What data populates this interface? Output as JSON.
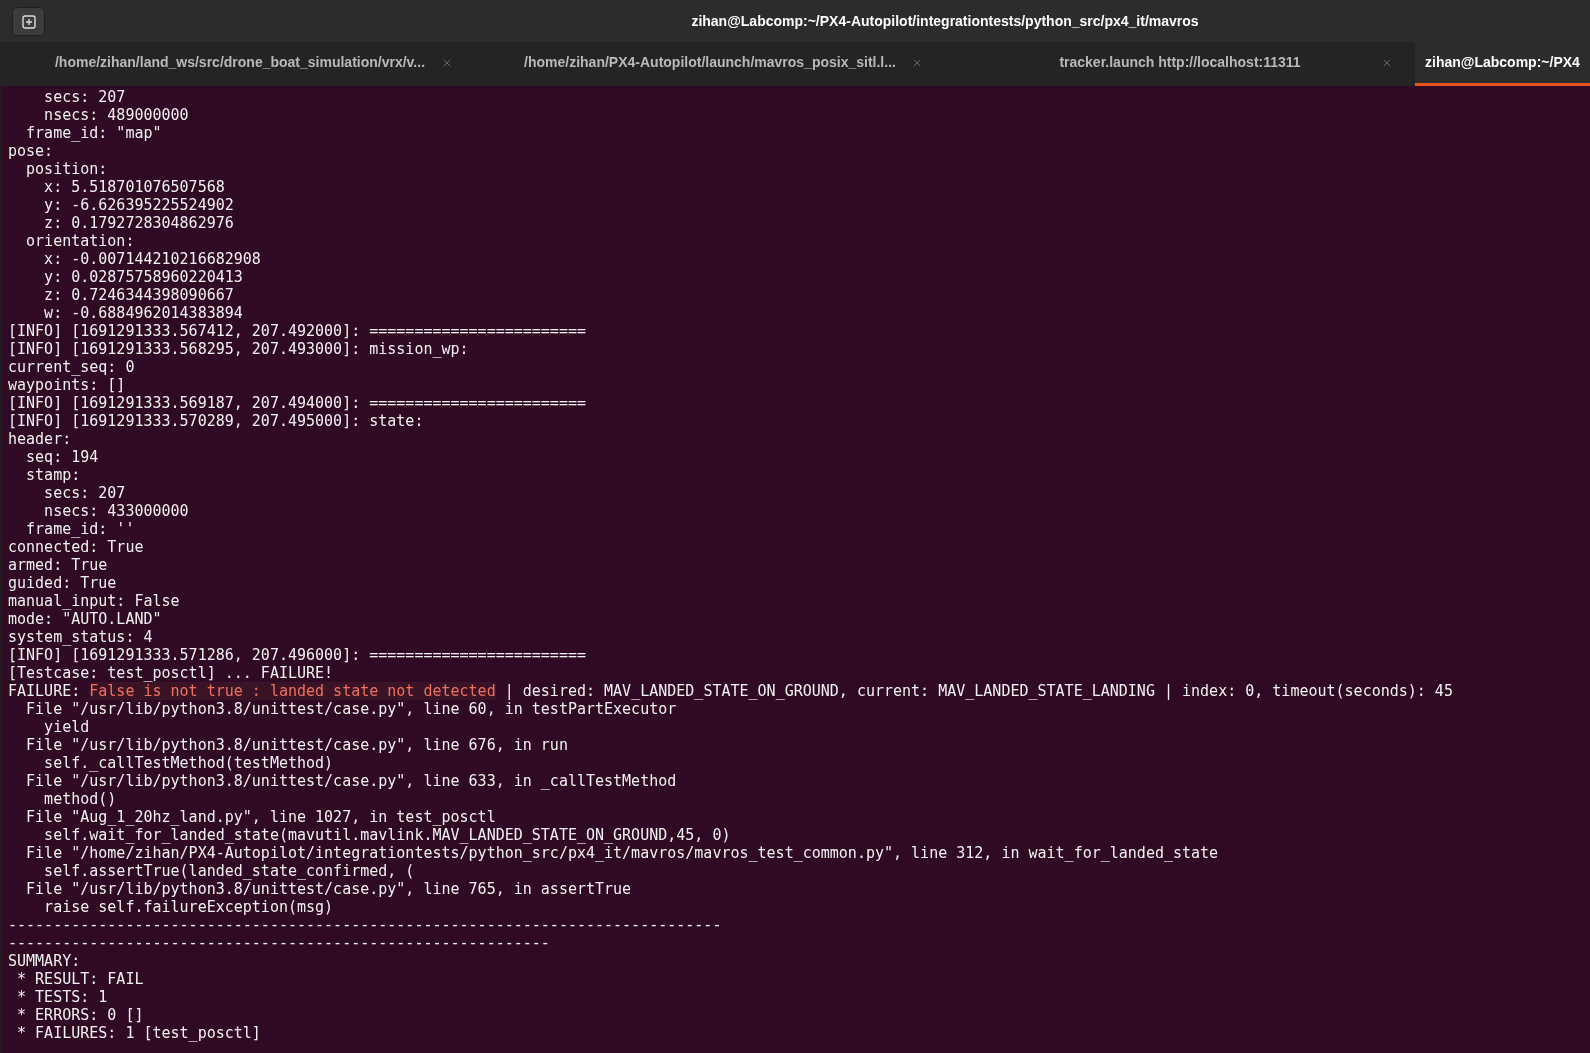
{
  "window": {
    "title": "zihan@Labcomp:~/PX4-Autopilot/integrationtests/python_src/px4_it/mavros"
  },
  "tabs": [
    {
      "label": "/home/zihan/land_ws/src/drone_boat_simulation/vrx/v...",
      "selected": false
    },
    {
      "label": "/home/zihan/PX4-Autopilot/launch/mavros_posix_sitl.l...",
      "selected": false
    },
    {
      "label": "tracker.launch http://localhost:11311",
      "selected": false
    },
    {
      "label": "zihan@Labcomp:~/PX4",
      "selected": true
    }
  ],
  "terminal": {
    "lines": [
      {
        "kind": "plain",
        "text": "    secs: 207"
      },
      {
        "kind": "plain",
        "text": "    nsecs: 489000000"
      },
      {
        "kind": "plain",
        "text": "  frame_id: \"map\""
      },
      {
        "kind": "plain",
        "text": "pose:"
      },
      {
        "kind": "plain",
        "text": "  position:"
      },
      {
        "kind": "plain",
        "text": "    x: 5.518701076507568"
      },
      {
        "kind": "plain",
        "text": "    y: -6.626395225524902"
      },
      {
        "kind": "plain",
        "text": "    z: 0.1792728304862976"
      },
      {
        "kind": "plain",
        "text": "  orientation:"
      },
      {
        "kind": "plain",
        "text": "    x: -0.007144210216682908"
      },
      {
        "kind": "plain",
        "text": "    y: 0.02875758960220413"
      },
      {
        "kind": "plain",
        "text": "    z: 0.7246344398090667"
      },
      {
        "kind": "plain",
        "text": "    w: -0.6884962014383894"
      },
      {
        "kind": "plain",
        "text": "[INFO] [1691291333.567412, 207.492000]: ========================"
      },
      {
        "kind": "plain",
        "text": "[INFO] [1691291333.568295, 207.493000]: mission_wp:"
      },
      {
        "kind": "plain",
        "text": "current_seq: 0"
      },
      {
        "kind": "plain",
        "text": "waypoints: []"
      },
      {
        "kind": "plain",
        "text": "[INFO] [1691291333.569187, 207.494000]: ========================"
      },
      {
        "kind": "plain",
        "text": "[INFO] [1691291333.570289, 207.495000]: state:"
      },
      {
        "kind": "plain",
        "text": "header:"
      },
      {
        "kind": "plain",
        "text": "  seq: 194"
      },
      {
        "kind": "plain",
        "text": "  stamp:"
      },
      {
        "kind": "plain",
        "text": "    secs: 207"
      },
      {
        "kind": "plain",
        "text": "    nsecs: 433000000"
      },
      {
        "kind": "plain",
        "text": "  frame_id: ''"
      },
      {
        "kind": "plain",
        "text": "connected: True"
      },
      {
        "kind": "plain",
        "text": "armed: True"
      },
      {
        "kind": "plain",
        "text": "guided: True"
      },
      {
        "kind": "plain",
        "text": "manual_input: False"
      },
      {
        "kind": "plain",
        "text": "mode: \"AUTO.LAND\""
      },
      {
        "kind": "plain",
        "text": "system_status: 4"
      },
      {
        "kind": "plain",
        "text": "[INFO] [1691291333.571286, 207.496000]: ========================"
      },
      {
        "kind": "plain",
        "text": "[Testcase: test_posctl] ... FAILURE!"
      },
      {
        "kind": "failure",
        "label": "FAILURE: ",
        "message": "False is not true : landed state not detected",
        "detail": " | desired: MAV_LANDED_STATE_ON_GROUND, current: MAV_LANDED_STATE_LANDING | index: 0, timeout(seconds): 45"
      },
      {
        "kind": "plain",
        "text": "  File \"/usr/lib/python3.8/unittest/case.py\", line 60, in testPartExecutor"
      },
      {
        "kind": "plain",
        "text": "    yield"
      },
      {
        "kind": "plain",
        "text": "  File \"/usr/lib/python3.8/unittest/case.py\", line 676, in run"
      },
      {
        "kind": "plain",
        "text": "    self._callTestMethod(testMethod)"
      },
      {
        "kind": "plain",
        "text": "  File \"/usr/lib/python3.8/unittest/case.py\", line 633, in _callTestMethod"
      },
      {
        "kind": "plain",
        "text": "    method()"
      },
      {
        "kind": "plain",
        "text": "  File \"Aug_1_20hz_land.py\", line 1027, in test_posctl"
      },
      {
        "kind": "plain",
        "text": "    self.wait_for_landed_state(mavutil.mavlink.MAV_LANDED_STATE_ON_GROUND,45, 0)"
      },
      {
        "kind": "plain",
        "text": "  File \"/home/zihan/PX4-Autopilot/integrationtests/python_src/px4_it/mavros/mavros_test_common.py\", line 312, in wait_for_landed_state"
      },
      {
        "kind": "plain",
        "text": "    self.assertTrue(landed_state_confirmed, ("
      },
      {
        "kind": "plain",
        "text": "  File \"/usr/lib/python3.8/unittest/case.py\", line 765, in assertTrue"
      },
      {
        "kind": "plain",
        "text": "    raise self.failureException(msg)"
      },
      {
        "kind": "plain",
        "text": "-------------------------------------------------------------------------------"
      },
      {
        "kind": "plain",
        "text": "------------------------------------------------------------"
      },
      {
        "kind": "plain",
        "text": "SUMMARY:"
      },
      {
        "kind": "plain",
        "text": " * RESULT: FAIL"
      },
      {
        "kind": "plain",
        "text": " * TESTS: 1"
      },
      {
        "kind": "plain",
        "text": " * ERRORS: 0 []"
      },
      {
        "kind": "plain",
        "text": " * FAILURES: 1 [test_posctl]"
      }
    ]
  }
}
